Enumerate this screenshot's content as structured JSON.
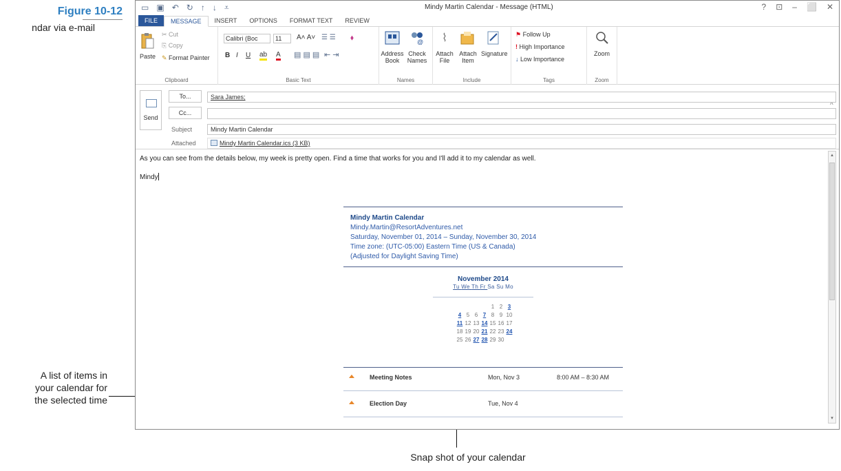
{
  "figure": {
    "label": "Figure 10-12",
    "caption": "ndar via e-mail"
  },
  "callouts": {
    "left": [
      "A list of items in",
      "your calendar for",
      "the selected time"
    ],
    "bottom": "Snap shot of your calendar"
  },
  "window": {
    "title": "Mindy Martin Calendar - Message (HTML)",
    "controls": [
      "?",
      "⊡",
      "–",
      "⬜",
      "✕"
    ]
  },
  "tabs": [
    "FILE",
    "MESSAGE",
    "INSERT",
    "OPTIONS",
    "FORMAT TEXT",
    "REVIEW"
  ],
  "ribbon": {
    "clipboard": {
      "label": "Clipboard",
      "paste": "Paste",
      "cut": "Cut",
      "copy": "Copy",
      "format_painter": "Format Painter"
    },
    "basic_text": {
      "label": "Basic Text",
      "font": "Calibri (Boc",
      "size": "11"
    },
    "names": {
      "label": "Names",
      "address_book": [
        "Address",
        "Book"
      ],
      "check_names": [
        "Check",
        "Names"
      ]
    },
    "include": {
      "label": "Include",
      "attach_file": [
        "Attach",
        "File"
      ],
      "attach_item": [
        "Attach",
        "Item"
      ],
      "signature": "Signature"
    },
    "tags": {
      "label": "Tags",
      "follow_up": "Follow Up",
      "high": "High Importance",
      "low": "Low Importance"
    },
    "zoom": {
      "label": "Zoom",
      "zoom": "Zoom"
    }
  },
  "compose": {
    "send": "Send",
    "to_btn": "To...",
    "cc_btn": "Cc...",
    "to_value": "Sara James;",
    "cc_value": "",
    "subject_label": "Subject",
    "subject_value": "Mindy Martin Calendar",
    "attached_label": "Attached",
    "attachment": "Mindy Martin Calendar.ics (3 KB)"
  },
  "message": {
    "line1": "As you can see from the details below, my week is pretty open. Find a time that works for you and I'll add it to my calendar as well.",
    "signature": "Mindy"
  },
  "calendar": {
    "name": "Mindy Martin Calendar",
    "email": "Mindy.Martin@ResortAdventures.net",
    "range": "Saturday, November 01, 2014 – Sunday, November 30, 2014",
    "timezone": "Time zone: (UTC-05:00) Eastern Time (US & Canada)",
    "dst": "(Adjusted for Daylight Saving Time)",
    "month": "November 2014",
    "weekdays": [
      "Tu",
      "We",
      "Th",
      "Fr",
      "Sa",
      "Su",
      "Mo"
    ],
    "weeks": [
      [
        "",
        "",
        "",
        "",
        "1",
        "2",
        "3"
      ],
      [
        "4",
        "5",
        "6",
        "7",
        "8",
        "9",
        "10"
      ],
      [
        "11",
        "12",
        "13",
        "14",
        "15",
        "16",
        "17"
      ],
      [
        "18",
        "19",
        "20",
        "21",
        "22",
        "23",
        "24"
      ],
      [
        "25",
        "26",
        "27",
        "28",
        "29",
        "30",
        ""
      ]
    ],
    "busy_days": [
      "3",
      "4",
      "7",
      "11",
      "14",
      "21",
      "24",
      "27",
      "28"
    ],
    "items": [
      {
        "name": "Meeting Notes",
        "date": "Mon, Nov 3",
        "time": "8:00 AM – 8:30 AM"
      },
      {
        "name": "Election Day",
        "date": "Tue, Nov 4",
        "time": ""
      }
    ]
  },
  "colors": {
    "file_tab": "#2b579a",
    "accent": "#2e5aa8",
    "figure_label": "#2e7fc1"
  }
}
